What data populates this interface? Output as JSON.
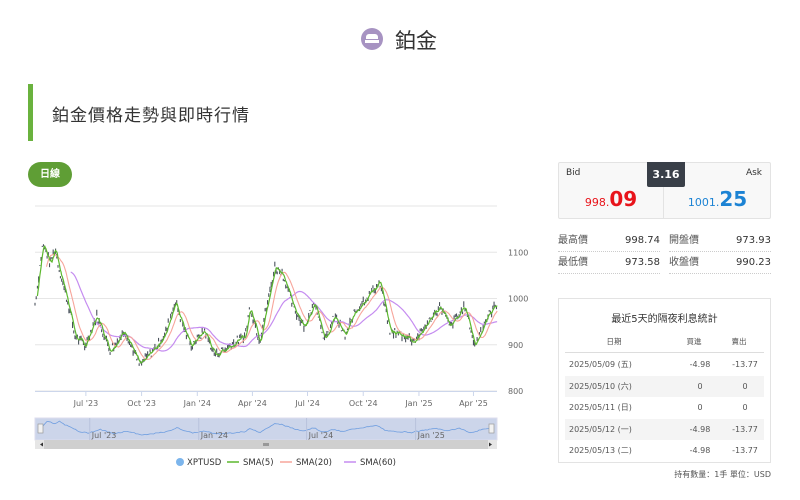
{
  "header": {
    "title": "鉑金",
    "icon": "platinum-bar-icon",
    "icon_color": "#a793c2"
  },
  "section": {
    "title": "鉑金價格走勢與即時行情",
    "accent": "#6ab23e"
  },
  "period_button": "日線",
  "quote": {
    "bid_label": "Bid",
    "ask_label": "Ask",
    "spread": "3.16",
    "bid_main": "998.",
    "bid_frac": "09",
    "ask_main": "1001.",
    "ask_frac": "25",
    "bid_color": "#e8141b",
    "ask_color": "#1c83d4"
  },
  "stats": [
    {
      "label": "最高價",
      "value": "998.74"
    },
    {
      "label": "開盤價",
      "value": "973.93"
    },
    {
      "label": "最低價",
      "value": "973.58"
    },
    {
      "label": "收盤價",
      "value": "990.23"
    }
  ],
  "interest": {
    "title": "最近5天的隔夜利息統計",
    "headers": [
      "日期",
      "買進",
      "賣出"
    ],
    "rows": [
      [
        "2025/05/09 (五)",
        "-4.98",
        "-13.77"
      ],
      [
        "2025/05/10 (六)",
        "0",
        "0"
      ],
      [
        "2025/05/11 (日)",
        "0",
        "0"
      ],
      [
        "2025/05/12 (一)",
        "-4.98",
        "-13.77"
      ],
      [
        "2025/05/13 (二)",
        "-4.98",
        "-13.77"
      ]
    ],
    "footer": "持有數量：1手 單位：USD"
  },
  "chart_data": {
    "type": "line",
    "ylim": [
      800,
      1200
    ],
    "yticks": [
      "800",
      "900",
      "1000",
      "1100"
    ],
    "xticks": [
      "Jul '23",
      "Oct '23",
      "Jan '24",
      "Apr '24",
      "Jul '24",
      "Oct '24",
      "Jan '25",
      "Apr '25"
    ],
    "navigator_ticks": [
      "Jul '23",
      "Jan '24",
      "Jul '24",
      "Jan '25"
    ],
    "grid": true,
    "legend_position": "bottom",
    "series_names": [
      "XPTUSD",
      "SMA(5)",
      "SMA(20)",
      "SMA(60)"
    ],
    "colors": {
      "XPTUSD": "#7cb5ec",
      "candle": "#2b3540",
      "SMA(5)": "#5cb82e",
      "SMA(20)": "#f7a59b",
      "SMA(60)": "#c58cf0"
    },
    "x": [
      "2023-04-08",
      "2023-04-21",
      "2023-05-03",
      "2023-05-11",
      "2023-05-19",
      "2023-06-01",
      "2023-06-13",
      "2023-06-29",
      "2023-07-19",
      "2023-08-10",
      "2023-09-03",
      "2023-09-28",
      "2023-11-08",
      "2023-11-25",
      "2023-12-20",
      "2024-01-13",
      "2024-01-30",
      "2024-02-24",
      "2024-03-20",
      "2024-03-28",
      "2024-04-13",
      "2024-05-08",
      "2024-05-20",
      "2024-06-10",
      "2024-06-27",
      "2024-07-13",
      "2024-07-30",
      "2024-08-15",
      "2024-09-01",
      "2024-09-17",
      "2024-10-28",
      "2024-11-14",
      "2024-12-09",
      "2024-12-25",
      "2025-01-11",
      "2025-02-05",
      "2025-02-21",
      "2025-03-18",
      "2025-04-03",
      "2025-04-20",
      "2025-05-10"
    ],
    "close": [
      987,
      1121,
      1074,
      1110,
      1057,
      994,
      919,
      898,
      962,
      887,
      930,
      855,
      919,
      994,
      898,
      930,
      877,
      898,
      919,
      983,
      908,
      1068,
      1057,
      972,
      940,
      994,
      908,
      962,
      919,
      972,
      1036,
      930,
      919,
      908,
      940,
      983,
      940,
      983,
      898,
      951,
      990
    ]
  }
}
